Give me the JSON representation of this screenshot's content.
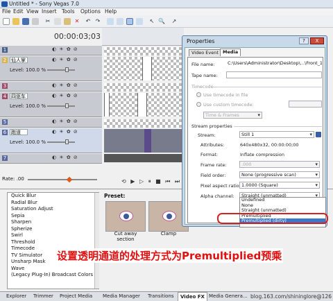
{
  "window": {
    "title": "Untitled * - Sony Vegas 7.0"
  },
  "menu": [
    "File",
    "Edit",
    "View",
    "Insert",
    "Tools",
    "Options",
    "Help"
  ],
  "timecode": "00:00:03;03",
  "tracks": [
    {
      "num": "1",
      "name": "",
      "level": ""
    },
    {
      "num": "2",
      "name": "仙人掌",
      "level": "Level: 100.0 %"
    },
    {
      "num": "3",
      "name": "",
      "level": ""
    },
    {
      "num": "4",
      "name": "四驱车",
      "level": "Level: 100.0 %"
    },
    {
      "num": "5",
      "name": "",
      "level": ""
    },
    {
      "num": "6",
      "name": "跑道",
      "level": "Level: 100.0 %"
    },
    {
      "num": "7",
      "name": "",
      "level": ""
    }
  ],
  "rate": "Rate: .00",
  "fx_list": [
    "Quick Blur",
    "Radial Blur",
    "Saturation Adjust",
    "Sepia",
    "Sharpen",
    "Spherize",
    "Swirl",
    "Threshold",
    "Timecode",
    "TV Simulator",
    "Unsharp Mask",
    "Wave",
    "(Legacy Plug-In) Broadcast Colors"
  ],
  "preset": {
    "label": "Preset:",
    "items": [
      "Cut away section",
      "Clamp"
    ]
  },
  "bottom_tabs": [
    "Explorer",
    "Trimmer",
    "Project Media",
    "Media Manager",
    "Transitions",
    "Video FX",
    "Media Genera..."
  ],
  "watermark": "blog.163.com/shininglore@126",
  "annotation": "设置透明通道的处理方式为Premultiplied预乘",
  "dialog": {
    "title": "Properties",
    "help": "?",
    "close": "X",
    "tabs": [
      "Video Event",
      "Media"
    ],
    "file_name_label": "File name:",
    "file_name_value": "C:\\Users\\Administrator\\Desktop\\...\\Front_1.png",
    "tape_name_label": "Tape name:",
    "timecode_header": "Timecode",
    "use_timecode_in_file": "Use timecode in file",
    "use_custom_timecode": "Use custom timecode:",
    "time_format": "Time & Frames",
    "stream_properties": "Stream properties",
    "stream_label": "Stream:",
    "stream_value": "Still 1",
    "attributes_label": "Attributes:",
    "attributes_value": "640x480x32, 00:00:00;00",
    "format_label": "Format:",
    "format_value": "Inflate compression",
    "frame_rate_label": "Frame rate:",
    "frame_rate_value": ".000",
    "field_order_label": "Field order:",
    "field_order_value": "None (progressive scan)",
    "par_label": "Pixel aspect ratio:",
    "par_value": "1.0000 (Square)",
    "alpha_label": "Alpha channel:",
    "alpha_value": "Straight (unmatted)",
    "alpha_options": [
      "Undefined",
      "None",
      "Straight (unmatted)",
      "Premultiplied",
      "Premultiplied (dirty)"
    ]
  }
}
